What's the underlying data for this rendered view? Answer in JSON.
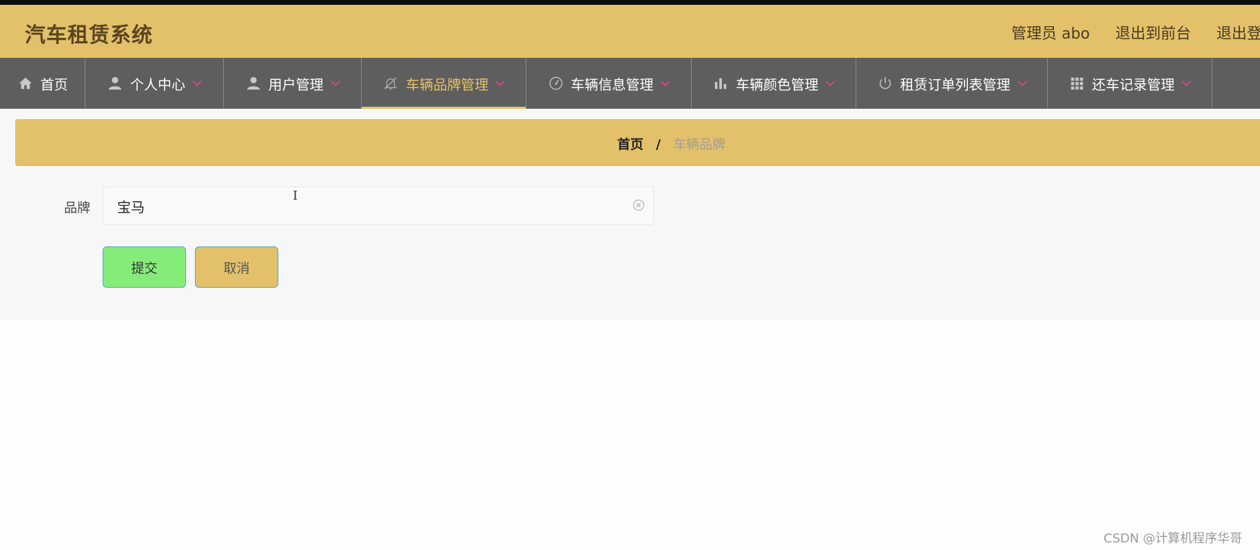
{
  "header": {
    "title": "汽车租赁系统",
    "user_label": "管理员 abo",
    "to_frontend": "退出到前台",
    "logout": "退出登录"
  },
  "nav": {
    "items": [
      {
        "label": "首页",
        "icon": "home-icon",
        "has_dropdown": false,
        "active": false
      },
      {
        "label": "个人中心",
        "icon": "person-icon",
        "has_dropdown": true,
        "active": false
      },
      {
        "label": "用户管理",
        "icon": "user-icon",
        "has_dropdown": true,
        "active": false
      },
      {
        "label": "车辆品牌管理",
        "icon": "bell-off-icon",
        "has_dropdown": true,
        "active": true
      },
      {
        "label": "车辆信息管理",
        "icon": "gauge-icon",
        "has_dropdown": true,
        "active": false
      },
      {
        "label": "车辆颜色管理",
        "icon": "bar-chart-icon",
        "has_dropdown": true,
        "active": false
      },
      {
        "label": "租赁订单列表管理",
        "icon": "power-icon",
        "has_dropdown": true,
        "active": false
      },
      {
        "label": "还车记录管理",
        "icon": "grid-icon",
        "has_dropdown": true,
        "active": false
      }
    ]
  },
  "breadcrumb": {
    "home": "首页",
    "separator": "/",
    "current": "车辆品牌"
  },
  "form": {
    "brand_label": "品牌",
    "brand_value": "宝马",
    "cursor_glyph": "I",
    "submit_label": "提交",
    "cancel_label": "取消"
  },
  "watermark": "CSDN @计算机程序华哥",
  "colors": {
    "header_bg": "#e3c16a",
    "nav_bg": "#5e5e5e",
    "nav_active_text": "#e7c063",
    "submit_bg": "#86ec79",
    "cancel_bg": "#e3c16a",
    "chevron": "#d9488a"
  }
}
